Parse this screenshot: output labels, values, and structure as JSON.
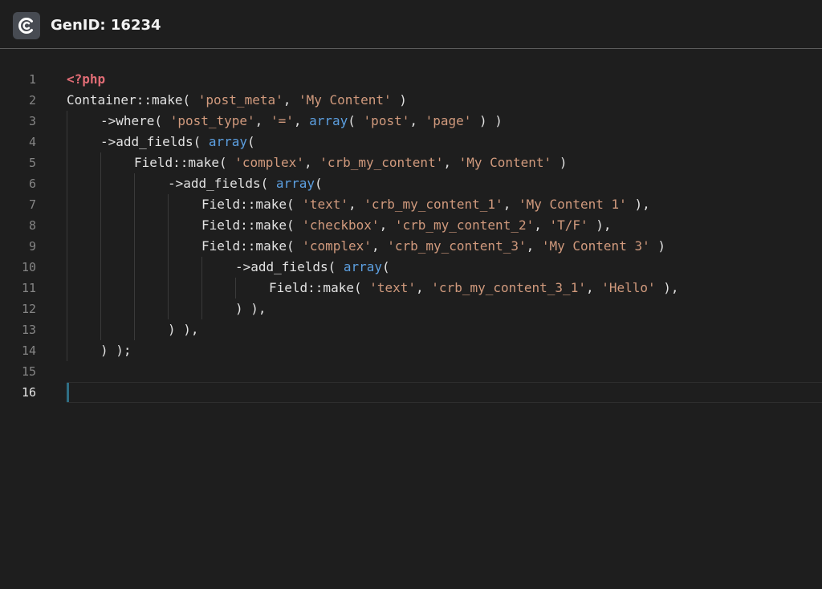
{
  "header": {
    "title": "GenID: 16234",
    "logo_icon": "genid-logo-icon"
  },
  "editor": {
    "active_line": 16,
    "lines": [
      {
        "num": "1",
        "indent": 0,
        "tokens": [
          {
            "t": "tag",
            "v": "<?php"
          }
        ]
      },
      {
        "num": "2",
        "indent": 0,
        "tokens": [
          {
            "t": "plain",
            "v": "Container::make( "
          },
          {
            "t": "str",
            "v": "'post_meta'"
          },
          {
            "t": "plain",
            "v": ", "
          },
          {
            "t": "str",
            "v": "'My Content'"
          },
          {
            "t": "plain",
            "v": " )"
          }
        ]
      },
      {
        "num": "3",
        "indent": 1,
        "tokens": [
          {
            "t": "plain",
            "v": "->where( "
          },
          {
            "t": "str",
            "v": "'post_type'"
          },
          {
            "t": "plain",
            "v": ", "
          },
          {
            "t": "str",
            "v": "'='"
          },
          {
            "t": "plain",
            "v": ", "
          },
          {
            "t": "kw",
            "v": "array"
          },
          {
            "t": "plain",
            "v": "( "
          },
          {
            "t": "str",
            "v": "'post'"
          },
          {
            "t": "plain",
            "v": ", "
          },
          {
            "t": "str",
            "v": "'page'"
          },
          {
            "t": "plain",
            "v": " ) )"
          }
        ]
      },
      {
        "num": "4",
        "indent": 1,
        "tokens": [
          {
            "t": "plain",
            "v": "->add_fields( "
          },
          {
            "t": "kw",
            "v": "array"
          },
          {
            "t": "plain",
            "v": "("
          }
        ]
      },
      {
        "num": "5",
        "indent": 2,
        "tokens": [
          {
            "t": "plain",
            "v": "Field::make( "
          },
          {
            "t": "str",
            "v": "'complex'"
          },
          {
            "t": "plain",
            "v": ", "
          },
          {
            "t": "str",
            "v": "'crb_my_content'"
          },
          {
            "t": "plain",
            "v": ", "
          },
          {
            "t": "str",
            "v": "'My Content'"
          },
          {
            "t": "plain",
            "v": " )"
          }
        ]
      },
      {
        "num": "6",
        "indent": 3,
        "tokens": [
          {
            "t": "plain",
            "v": "->add_fields( "
          },
          {
            "t": "kw",
            "v": "array"
          },
          {
            "t": "plain",
            "v": "("
          }
        ]
      },
      {
        "num": "7",
        "indent": 4,
        "tokens": [
          {
            "t": "plain",
            "v": "Field::make( "
          },
          {
            "t": "str",
            "v": "'text'"
          },
          {
            "t": "plain",
            "v": ", "
          },
          {
            "t": "str",
            "v": "'crb_my_content_1'"
          },
          {
            "t": "plain",
            "v": ", "
          },
          {
            "t": "str",
            "v": "'My Content 1'"
          },
          {
            "t": "plain",
            "v": " ),"
          }
        ]
      },
      {
        "num": "8",
        "indent": 4,
        "tokens": [
          {
            "t": "plain",
            "v": "Field::make( "
          },
          {
            "t": "str",
            "v": "'checkbox'"
          },
          {
            "t": "plain",
            "v": ", "
          },
          {
            "t": "str",
            "v": "'crb_my_content_2'"
          },
          {
            "t": "plain",
            "v": ", "
          },
          {
            "t": "str",
            "v": "'T/F'"
          },
          {
            "t": "plain",
            "v": " ),"
          }
        ]
      },
      {
        "num": "9",
        "indent": 4,
        "tokens": [
          {
            "t": "plain",
            "v": "Field::make( "
          },
          {
            "t": "str",
            "v": "'complex'"
          },
          {
            "t": "plain",
            "v": ", "
          },
          {
            "t": "str",
            "v": "'crb_my_content_3'"
          },
          {
            "t": "plain",
            "v": ", "
          },
          {
            "t": "str",
            "v": "'My Content 3'"
          },
          {
            "t": "plain",
            "v": " )"
          }
        ]
      },
      {
        "num": "10",
        "indent": 5,
        "tokens": [
          {
            "t": "plain",
            "v": "->add_fields( "
          },
          {
            "t": "kw",
            "v": "array"
          },
          {
            "t": "plain",
            "v": "("
          }
        ]
      },
      {
        "num": "11",
        "indent": 6,
        "tokens": [
          {
            "t": "plain",
            "v": "Field::make( "
          },
          {
            "t": "str",
            "v": "'text'"
          },
          {
            "t": "plain",
            "v": ", "
          },
          {
            "t": "str",
            "v": "'crb_my_content_3_1'"
          },
          {
            "t": "plain",
            "v": ", "
          },
          {
            "t": "str",
            "v": "'Hello'"
          },
          {
            "t": "plain",
            "v": " ),"
          }
        ]
      },
      {
        "num": "12",
        "indent": 5,
        "tokens": [
          {
            "t": "plain",
            "v": ") ),"
          }
        ]
      },
      {
        "num": "13",
        "indent": 3,
        "tokens": [
          {
            "t": "plain",
            "v": ") ),"
          }
        ]
      },
      {
        "num": "14",
        "indent": 1,
        "tokens": [
          {
            "t": "plain",
            "v": ") );"
          }
        ]
      },
      {
        "num": "15",
        "indent": 0,
        "tokens": []
      },
      {
        "num": "16",
        "indent": 0,
        "tokens": []
      }
    ]
  }
}
